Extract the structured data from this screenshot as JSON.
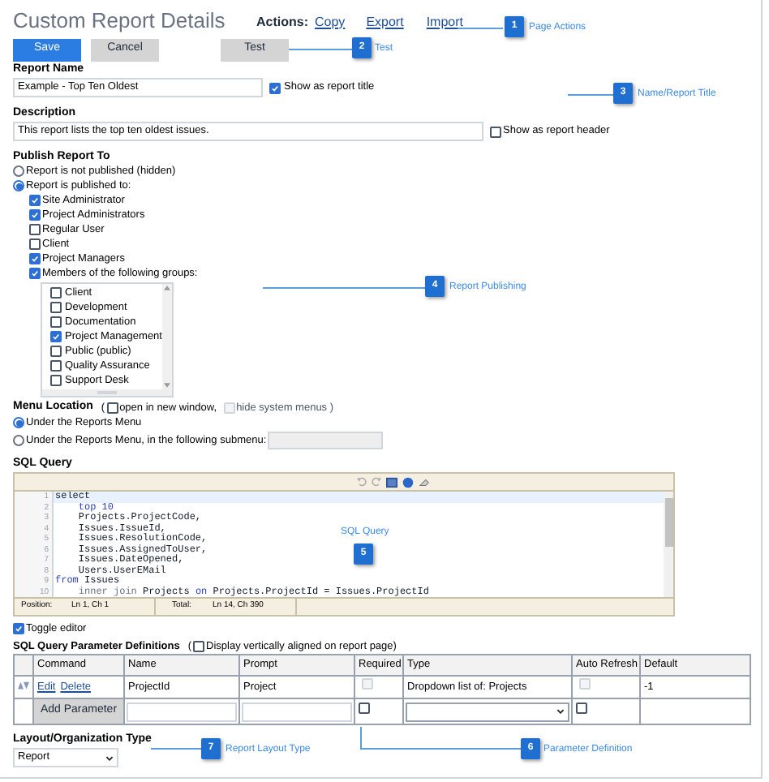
{
  "title": "Custom Report Details",
  "actions": {
    "label": "Actions:",
    "links": [
      "Copy",
      "Export",
      "Import"
    ]
  },
  "buttons": [
    {
      "label": "Save",
      "kind": "primary"
    },
    {
      "label": "Cancel",
      "kind": "secondary"
    },
    {
      "label": "Test",
      "kind": "test"
    }
  ],
  "report_name": {
    "label": "Report Name",
    "value": "Example - Top Ten Oldest",
    "option": {
      "label": "Show as report title",
      "checked": true
    }
  },
  "description": {
    "label": "Description",
    "value": "This report lists the top ten oldest issues.",
    "option": {
      "label": "Show as report header",
      "checked": false
    }
  },
  "publish": {
    "label": "Publish Report To",
    "options": [
      {
        "label": "Report is not published (hidden)",
        "selected": false
      },
      {
        "label": "Report is published to:",
        "selected": true
      }
    ],
    "roles": [
      {
        "label": "Site Administrator",
        "checked": true
      },
      {
        "label": "Project Administrators",
        "checked": true
      },
      {
        "label": "Regular User",
        "checked": false
      },
      {
        "label": "Client",
        "checked": false
      },
      {
        "label": "Project Managers",
        "checked": true
      },
      {
        "label": "Members of the following groups:",
        "checked": true
      }
    ],
    "groups": [
      {
        "label": "Client",
        "checked": false
      },
      {
        "label": "Development",
        "checked": false
      },
      {
        "label": "Documentation",
        "checked": false
      },
      {
        "label": "Project Management",
        "checked": true
      },
      {
        "label": "Public (public)",
        "checked": false
      },
      {
        "label": "Quality Assurance",
        "checked": false
      },
      {
        "label": "Support Desk",
        "checked": false
      }
    ]
  },
  "menu_location": {
    "label": "Menu Location",
    "open_paren": "(",
    "options": [
      {
        "label": "open in new window,",
        "checked": false,
        "disabled": false
      },
      {
        "label": "hide system menus )",
        "checked": false,
        "disabled": true
      }
    ],
    "choices": [
      {
        "label": "Under the Reports Menu",
        "selected": true
      },
      {
        "label": "Under the Reports Menu, in the following submenu:",
        "selected": false
      }
    ]
  },
  "sql": {
    "label": "SQL Query",
    "lines": [
      {
        "number": "1",
        "tokens": [
          {
            "text": "select",
            "kind": "plain"
          }
        ]
      },
      {
        "number": "2",
        "tokens": [
          {
            "text": "    top 10",
            "kind": "keyword"
          }
        ]
      },
      {
        "number": "3",
        "tokens": [
          {
            "text": "    Projects.ProjectCode,",
            "kind": "plain"
          }
        ]
      },
      {
        "number": "4",
        "tokens": [
          {
            "text": "    Issues.IssueId,",
            "kind": "plain"
          }
        ]
      },
      {
        "number": "5",
        "tokens": [
          {
            "text": "    Issues.ResolutionCode,",
            "kind": "plain"
          }
        ]
      },
      {
        "number": "6",
        "tokens": [
          {
            "text": "    Issues.AssignedToUser,",
            "kind": "plain"
          }
        ]
      },
      {
        "number": "7",
        "tokens": [
          {
            "text": "    Issues.DateOpened,",
            "kind": "plain"
          }
        ]
      },
      {
        "number": "8",
        "tokens": [
          {
            "text": "    Users.UserEMail",
            "kind": "plain"
          }
        ]
      },
      {
        "number": "9",
        "tokens": [
          {
            "text": "from",
            "kind": "keyword"
          },
          {
            "text": " Issues",
            "kind": "plain"
          }
        ]
      },
      {
        "number": "10",
        "tokens": [
          {
            "text": "    inner join",
            "kind": "muted"
          },
          {
            "text": " Projects ",
            "kind": "plain"
          },
          {
            "text": "on",
            "kind": "keyword"
          },
          {
            "text": " Projects.ProjectId = Issues.ProjectId",
            "kind": "plain"
          }
        ]
      }
    ],
    "status": [
      {
        "label": "Position:",
        "value": "Ln 1, Ch 1"
      },
      {
        "label": "Total:",
        "value": "Ln 14, Ch 390"
      }
    ],
    "toggle": {
      "label": "Toggle editor",
      "checked": true
    }
  },
  "parameters": {
    "label": "SQL Query Parameter Definitions",
    "option": {
      "open_paren": "(",
      "label": "Display vertically aligned on report page)",
      "checked": false
    },
    "columns": [
      "Command",
      "Name",
      "Prompt",
      "Required",
      "Type",
      "Auto Refresh",
      "Default"
    ],
    "rows": [
      {
        "commands": [
          "Edit",
          "Delete"
        ],
        "name": "ProjectId",
        "prompt": "Project",
        "required": {
          "checked": false,
          "disabled": true
        },
        "type": "Dropdown list of: Projects",
        "auto_refresh": {
          "checked": false,
          "disabled": true
        },
        "default": "-1"
      }
    ],
    "add_button": "Add Parameter",
    "new_row": {
      "required": {
        "checked": false
      },
      "auto_refresh": {
        "checked": false
      }
    }
  },
  "layout_type": {
    "label": "Layout/Organization Type",
    "value": "Report"
  },
  "callouts": [
    {
      "number": "1",
      "label": "Page Actions"
    },
    {
      "number": "2",
      "label": "Test"
    },
    {
      "number": "3",
      "label": "Name/Report Title"
    },
    {
      "number": "4",
      "label": "Report Publishing"
    },
    {
      "number": "5",
      "label": "SQL Query"
    },
    {
      "number": "7",
      "label": "Report Layout Type"
    },
    {
      "number": "6",
      "label": "Parameter Definition"
    }
  ]
}
